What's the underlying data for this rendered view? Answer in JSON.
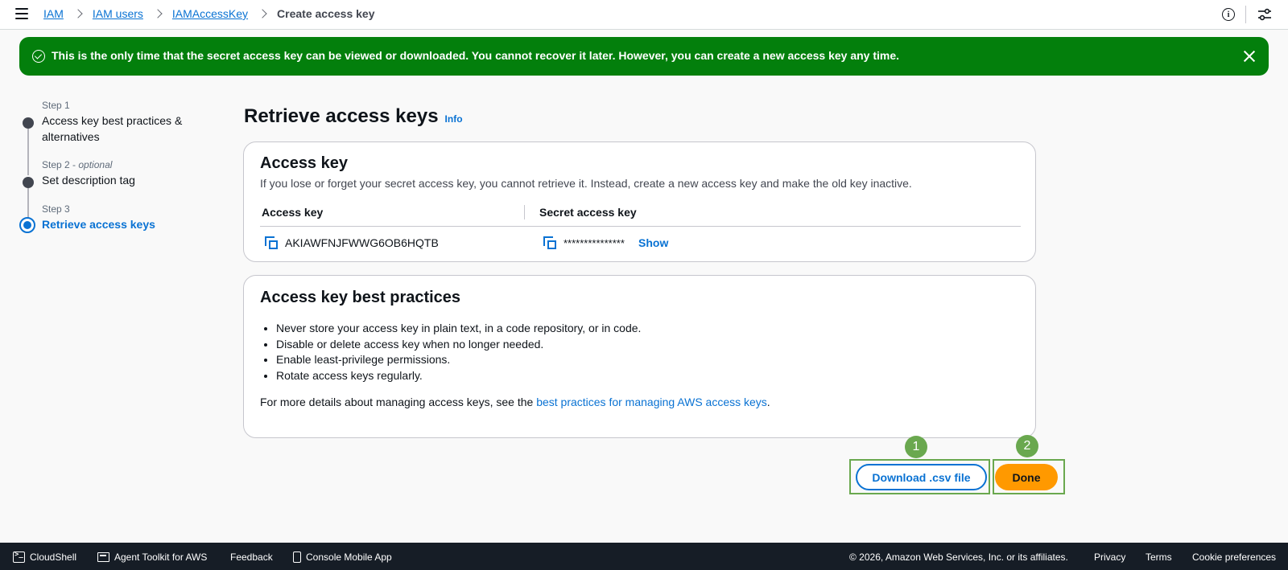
{
  "header": {
    "breadcrumbs": [
      "IAM",
      "IAM users",
      "IAMAccessKey"
    ],
    "current": "Create access key"
  },
  "flash": {
    "message": "This is the only time that the secret access key can be viewed or downloaded. You cannot recover it later. However, you can create a new access key any time."
  },
  "steps": [
    {
      "number": "Step 1",
      "optional": "",
      "title": "Access key best practices & alternatives"
    },
    {
      "number": "Step 2",
      "optional": "optional",
      "title": "Set description tag"
    },
    {
      "number": "Step 3",
      "optional": "",
      "title": "Retrieve access keys"
    }
  ],
  "step2_sep": " - ",
  "page": {
    "title": "Retrieve access keys",
    "info": "Info"
  },
  "access_key_card": {
    "title": "Access key",
    "description": "If you lose or forget your secret access key, you cannot retrieve it. Instead, create a new access key and make the old key inactive.",
    "col_access_key": "Access key",
    "col_secret_key": "Secret access key",
    "access_key_value": "AKIAWFNJFWWG6OB6HQTB",
    "secret_mask": "***************",
    "show_label": "Show"
  },
  "best_practices_card": {
    "title": "Access key best practices",
    "items": [
      "Never store your access key in plain text, in a code repository, or in code.",
      "Disable or delete access key when no longer needed.",
      "Enable least-privilege permissions.",
      "Rotate access keys regularly."
    ],
    "footer_prefix": "For more details about managing access keys, see the ",
    "footer_link": "best practices for managing AWS access keys",
    "footer_suffix": "."
  },
  "actions": {
    "download_label": "Download .csv file",
    "done_label": "Done",
    "badge_1": "1",
    "badge_2": "2"
  },
  "footer": {
    "cloudshell": "CloudShell",
    "agent_toolkit": "Agent Toolkit for AWS",
    "feedback": "Feedback",
    "mobile_app": "Console Mobile App",
    "copyright": "© 2026, Amazon Web Services, Inc. or its affiliates.",
    "privacy": "Privacy",
    "terms": "Terms",
    "cookies": "Cookie preferences"
  },
  "colors": {
    "flash_bg": "#037f0c",
    "link": "#0972d3",
    "primary_button": "#ff9900",
    "annotation": "#6aa84f",
    "footer_bg": "#161d26"
  }
}
